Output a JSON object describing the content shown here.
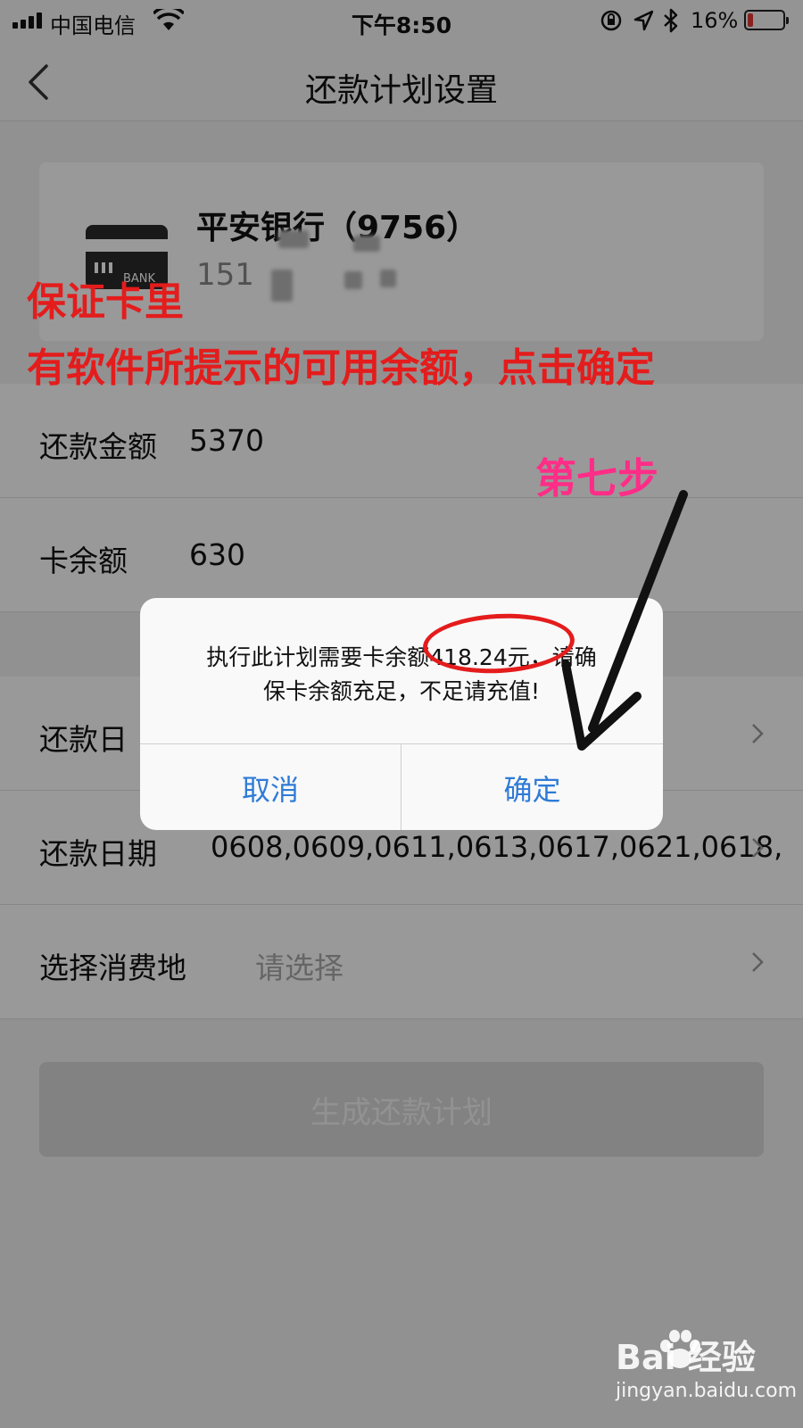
{
  "status_bar": {
    "carrier": "中国电信",
    "time": "下午8:50",
    "battery": "16%",
    "battery_level": 0.16
  },
  "nav": {
    "title": "还款计划设置",
    "back_icon": "chevron-left-icon"
  },
  "card": {
    "bank_name": "平安银行（9756）",
    "phone_prefix": "151",
    "icon_label": "BANK"
  },
  "form": {
    "amount_label": "还款金额",
    "amount_value": "5370",
    "balance_label": "卡余额",
    "balance_value": "630",
    "day_label": "还款日",
    "dates_label": "还款日期",
    "dates_value": "0608,0609,0611,0613,0617,0621,0618,",
    "location_label": "选择消费地",
    "location_placeholder": "请选择"
  },
  "generate_button": "生成还款计划",
  "dialog": {
    "message_line1": "执行此计划需要卡余额418.24元，请确",
    "message_line2": "保卡余额充足，不足请充值!",
    "cancel": "取消",
    "confirm": "确定"
  },
  "annotations": {
    "line1": "保证卡里",
    "line2": "有软件所提示的可用余额，点击确定",
    "step": "第七步",
    "red": "#e41c1c",
    "pink": "#ff2d87"
  },
  "watermark": {
    "brand": "Bai 经验",
    "url": "jingyan.baidu.com"
  },
  "colors": {
    "link_blue": "#2f7bd6",
    "button_disabled": "#d9d9d9"
  }
}
